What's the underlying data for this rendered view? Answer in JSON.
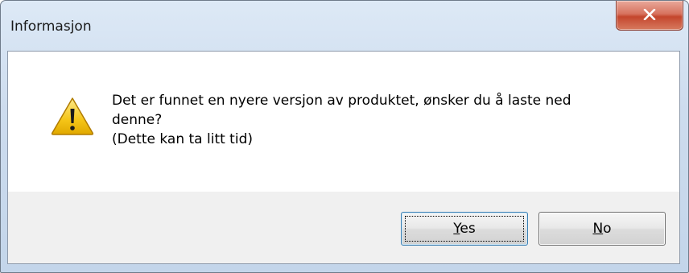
{
  "window": {
    "title": "Informasjon"
  },
  "dialog": {
    "icon": "warning-icon",
    "message_lines": [
      "Det er funnet en nyere versjon av produktet, ønsker du å laste ned",
      "denne?",
      "(Dette kan ta litt tid)"
    ]
  },
  "buttons": {
    "yes": {
      "mnemonic": "Y",
      "rest": "es"
    },
    "no": {
      "mnemonic": "N",
      "rest": "o"
    }
  },
  "colors": {
    "close_button": "#c4462d",
    "warning_fill": "#f5c518",
    "default_button_border": "#3c7fb1",
    "footer_bg": "#f0f0f0"
  }
}
